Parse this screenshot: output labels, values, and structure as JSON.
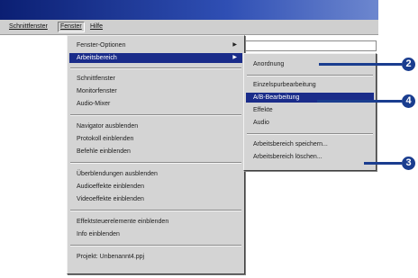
{
  "menubar": {
    "items": [
      "Schnittfenster",
      "Fenster",
      "Hilfe"
    ]
  },
  "main_menu": {
    "items": [
      {
        "label": "Fenster-Optionen",
        "submenu": true
      },
      {
        "label": "Arbeitsbereich",
        "submenu": true,
        "selected": true
      },
      {
        "label": "Schnittfenster"
      },
      {
        "label": "Monitorfenster"
      },
      {
        "label": "Audio-Mixer"
      },
      {
        "label": "Navigator ausblenden"
      },
      {
        "label": "Protokoll einblenden"
      },
      {
        "label": "Befehle einblenden"
      },
      {
        "label": "Überblendungen ausblenden"
      },
      {
        "label": "Audioeffekte einblenden"
      },
      {
        "label": "Videoeffekte einblenden"
      },
      {
        "label": "Effektsteuerelemente einblenden"
      },
      {
        "label": "Info einblenden"
      },
      {
        "label": "Projekt: Unbenannt4.ppj"
      }
    ]
  },
  "sub_menu": {
    "items": [
      {
        "label": "Anordnung"
      },
      {
        "label": "Einzelspurbearbeitung"
      },
      {
        "label": "A/B-Bearbeitung",
        "selected": true
      },
      {
        "label": "Effekte"
      },
      {
        "label": "Audio"
      },
      {
        "label": "Arbeitsbereich speichern..."
      },
      {
        "label": "Arbeitsbereich löschen..."
      }
    ]
  },
  "callouts": [
    "2",
    "4",
    "3"
  ],
  "colors": {
    "selection": "#1a2c8a",
    "callout": "#1a3d8f",
    "titlebar": "#0b1f73"
  }
}
